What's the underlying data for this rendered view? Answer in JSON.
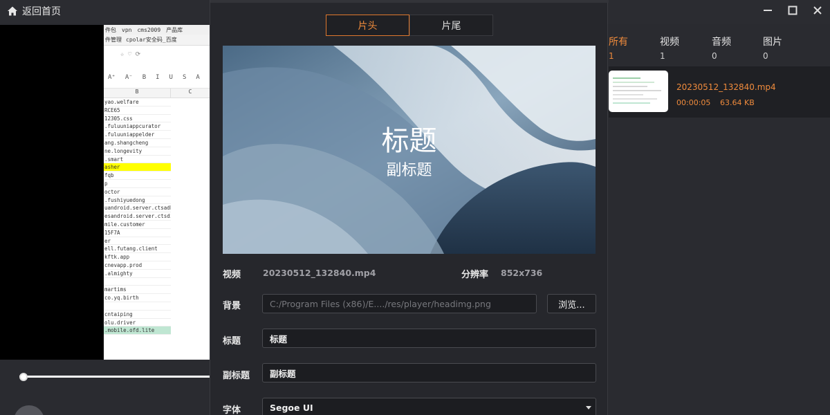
{
  "topbar": {
    "home_label": "返回首页"
  },
  "left_preview": {
    "tabs": [
      "件包",
      "vpn",
      "cms2009",
      "产品库"
    ],
    "tabs2": [
      "件管理",
      "cpolar安全码_百度"
    ],
    "format_icons": [
      "A⁺",
      "A⁻",
      "B",
      "I",
      "U",
      "S",
      "A"
    ],
    "columns": [
      "B",
      "C"
    ],
    "rows": [
      "yao.welfare",
      "RCE65",
      "12305.css",
      ".fuluuniappcurator",
      ".fuluuniappelder",
      "ang.shangcheng",
      "ne.longevity",
      ".smart",
      "asher",
      "fqb",
      "p",
      "octor",
      ".fushiyuedong",
      "uandroid.server.ctsadhere",
      "esandroid.server.ctsdissol",
      "mile.customer",
      "15F7A",
      "er",
      "ell.futang.client",
      "kftk.app",
      "cnevapp.prod",
      ".almighty",
      "",
      "martims",
      "co.yq.birth",
      "",
      "cntaiping",
      "olu.driver",
      ".mobile.ofd.lite"
    ]
  },
  "dialog": {
    "tabs": [
      {
        "label": "片头",
        "active": true
      },
      {
        "label": "片尾",
        "active": false
      }
    ],
    "poster": {
      "title": "标题",
      "subtitle": "副标题"
    },
    "video_label": "视频",
    "video_value": "20230512_132840.mp4",
    "resolution_label": "分辨率",
    "resolution_value": "852x736",
    "background_label": "背景",
    "background_placeholder": "C:/Program Files (x86)/E..../res/player/headimg.png",
    "browse_label": "浏览...",
    "title_label": "标题",
    "title_value": "标题",
    "subtitle_label": "副标题",
    "subtitle_value": "副标题",
    "font_label": "字体",
    "font_value": "Segoe UI"
  },
  "right_panel": {
    "filters": [
      {
        "label": "所有",
        "count": "1",
        "active": true
      },
      {
        "label": "视频",
        "count": "1",
        "active": false
      },
      {
        "label": "音频",
        "count": "0",
        "active": false
      },
      {
        "label": "图片",
        "count": "0",
        "active": false
      }
    ],
    "media": {
      "name": "20230512_132840.mp4",
      "duration": "00:00:05",
      "size": "63.64 KB"
    }
  },
  "colors": {
    "accent": "#f08b3c",
    "background": "#2a2b30",
    "dialog": "#26272c"
  }
}
